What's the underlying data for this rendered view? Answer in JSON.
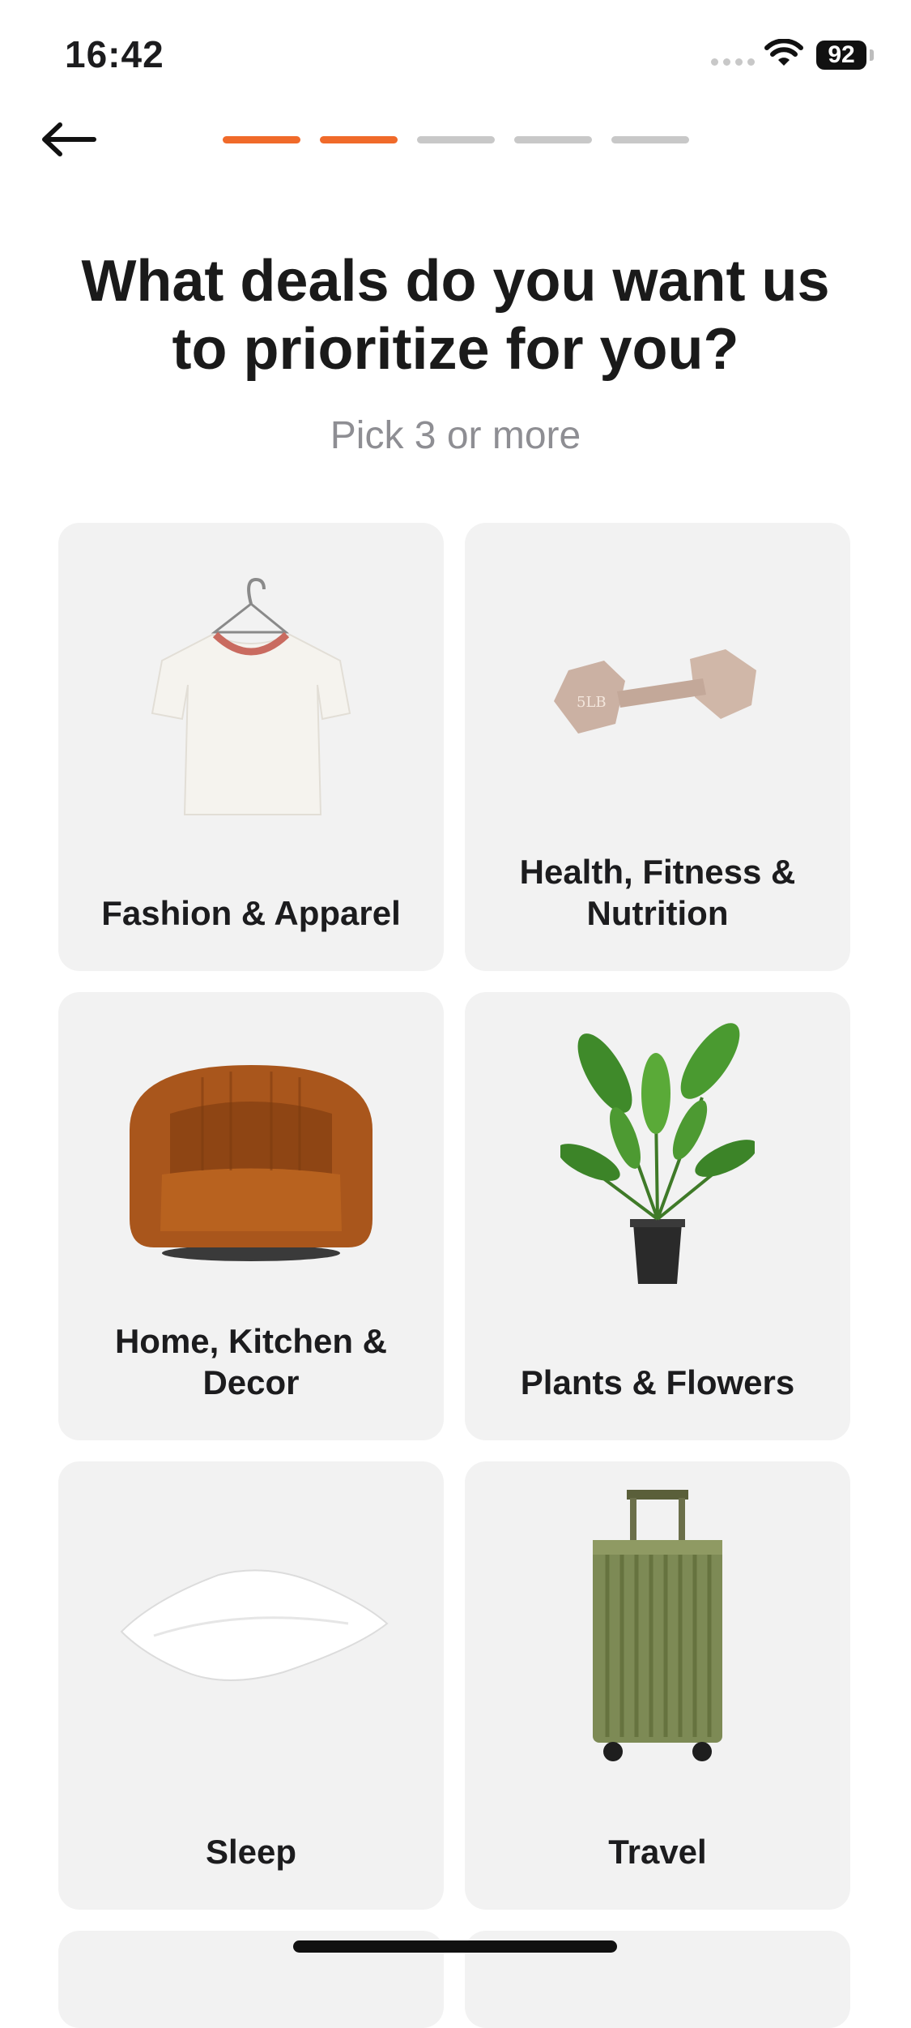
{
  "status_bar": {
    "time": "16:42",
    "battery": "92"
  },
  "progress": {
    "total_steps": 5,
    "completed_steps": 2
  },
  "header": {
    "title": "What deals do you want us to prioritize for you?",
    "subtitle": "Pick 3 or more"
  },
  "categories": [
    {
      "label": "Fashion & Apparel",
      "icon": "t-shirt-icon"
    },
    {
      "label": "Health, Fitness & Nutrition",
      "icon": "dumbbell-icon",
      "weight_text": "5LB"
    },
    {
      "label": "Home, Kitchen & Decor",
      "icon": "armchair-icon"
    },
    {
      "label": "Plants & Flowers",
      "icon": "potted-plant-icon"
    },
    {
      "label": "Sleep",
      "icon": "pillow-icon"
    },
    {
      "label": "Travel",
      "icon": "suitcase-icon"
    }
  ],
  "colors": {
    "accent": "#f06a2a",
    "card_bg": "#f2f2f2",
    "inactive_progress": "#c8c8c8"
  }
}
